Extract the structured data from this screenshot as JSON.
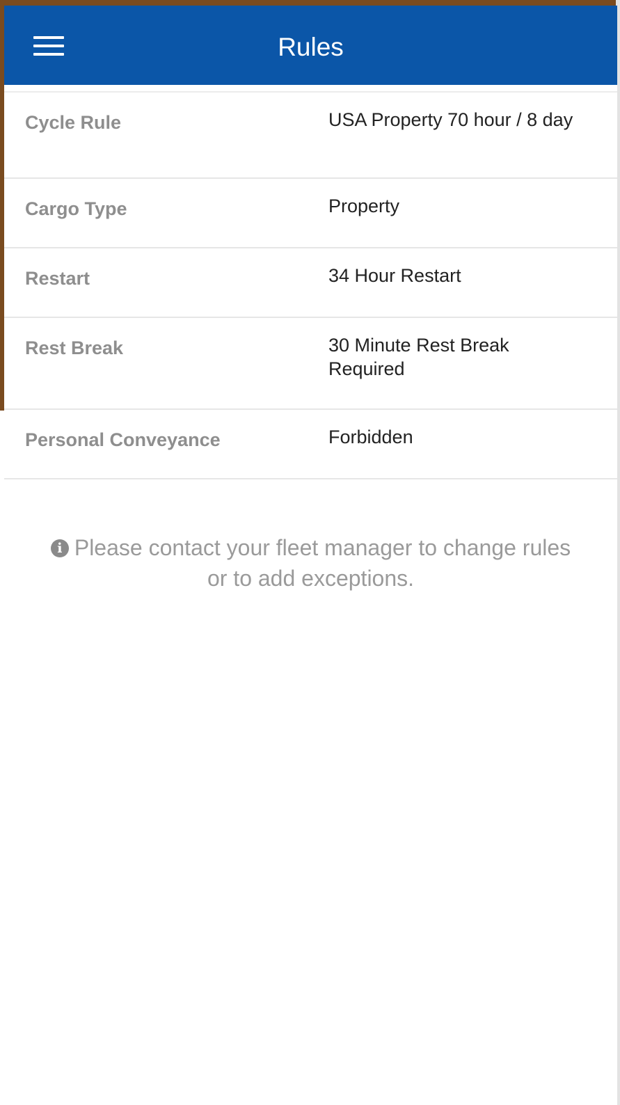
{
  "app_bar": {
    "title": "Rules",
    "menu_icon": "hamburger-menu-icon",
    "background_color": "#0b56a8"
  },
  "rules": [
    {
      "label": "Cycle Rule",
      "value": "USA Property 70 hour / 8 day"
    },
    {
      "label": "Cargo Type",
      "value": "Property"
    },
    {
      "label": "Restart",
      "value": "34 Hour Restart"
    },
    {
      "label": "Rest Break",
      "value": "30 Minute Rest Break Required"
    },
    {
      "label": "Personal Conveyance",
      "value": "Forbidden"
    }
  ],
  "notice": {
    "icon": "info-icon",
    "icon_glyph": "i",
    "text": "Please contact your fleet manager to change rules or to add exceptions."
  }
}
